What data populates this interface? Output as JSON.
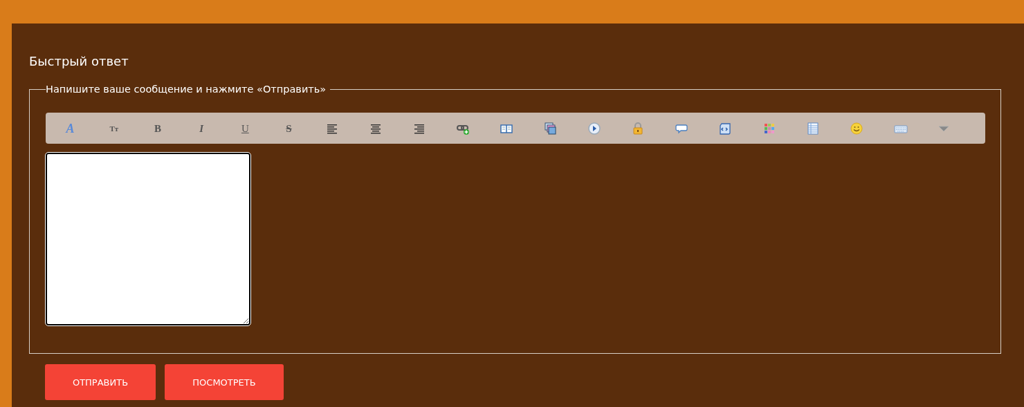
{
  "title": "Быстрый ответ",
  "form": {
    "legend": "Напишите ваше сообщение и нажмите «Отправить»",
    "toolbar": [
      {
        "kind": "font",
        "text": "A"
      },
      {
        "kind": "size",
        "text": "Tт"
      },
      {
        "kind": "bold",
        "text": "B"
      },
      {
        "kind": "italic",
        "text": "I"
      },
      {
        "kind": "underline",
        "text": "U"
      },
      {
        "kind": "strike",
        "text": "S"
      },
      {
        "kind": "alignleft"
      },
      {
        "kind": "aligncenter"
      },
      {
        "kind": "alignright"
      },
      {
        "kind": "link"
      },
      {
        "kind": "book"
      },
      {
        "kind": "images"
      },
      {
        "kind": "play"
      },
      {
        "kind": "lock"
      },
      {
        "kind": "speech"
      },
      {
        "kind": "script"
      },
      {
        "kind": "palette"
      },
      {
        "kind": "table"
      },
      {
        "kind": "smiley"
      },
      {
        "kind": "keyboard"
      },
      {
        "kind": "dropdown"
      }
    ]
  },
  "buttons": [
    {
      "label": "ОТПРАВИТЬ"
    },
    {
      "label": "ПОСМОТРЕТЬ"
    }
  ]
}
